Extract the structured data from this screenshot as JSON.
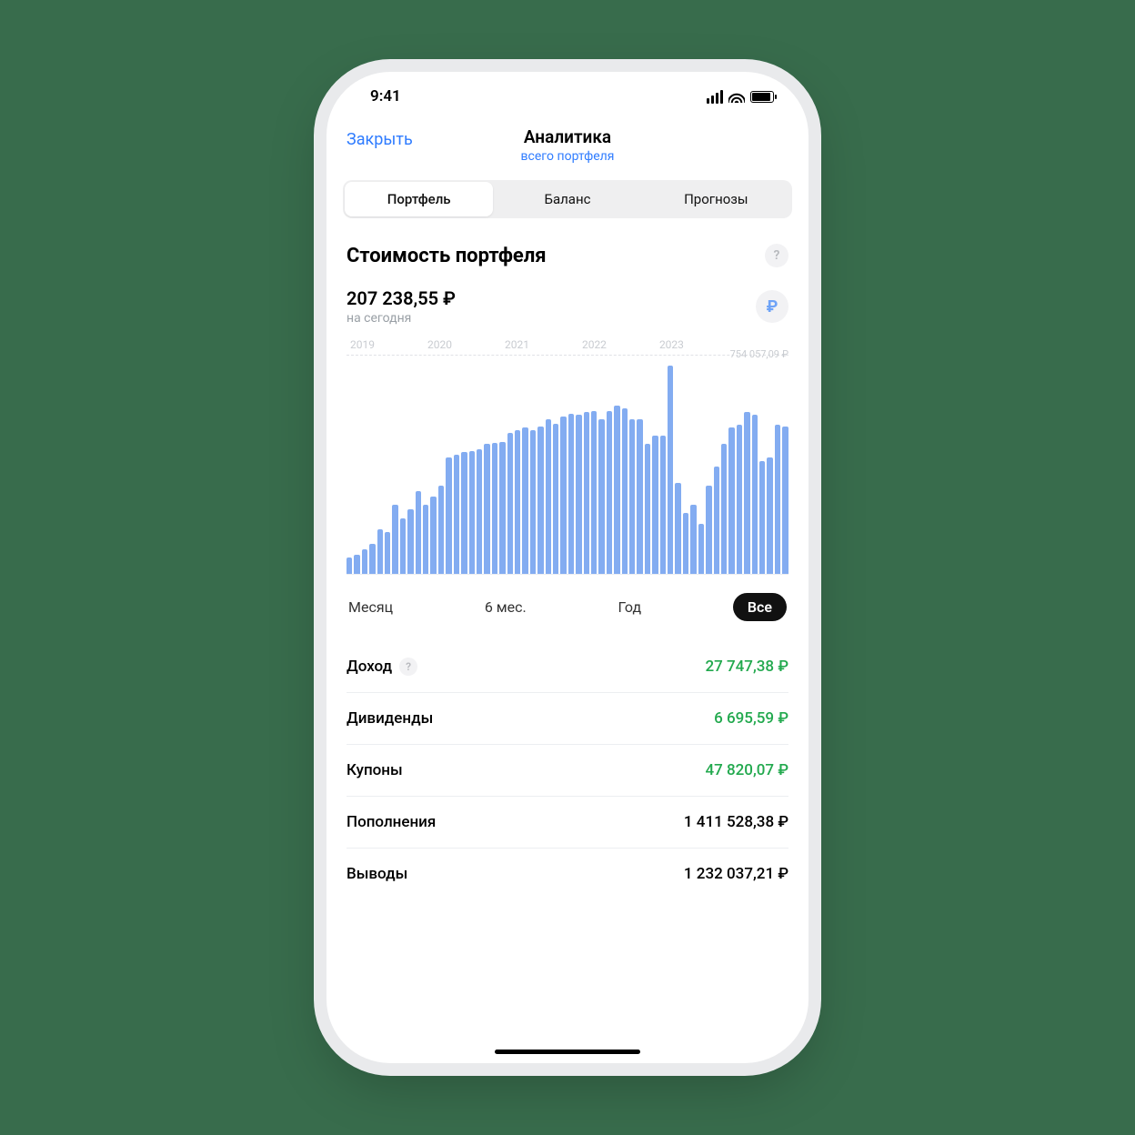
{
  "status": {
    "time": "9:41"
  },
  "nav": {
    "close": "Закрыть",
    "title": "Аналитика",
    "subtitle": "всего портфеля"
  },
  "segments": {
    "portfolio": "Портфель",
    "balance": "Баланс",
    "forecasts": "Прогнозы"
  },
  "section": {
    "title": "Стоимость портфеля",
    "help": "?"
  },
  "value": {
    "amount": "207 238,55 ₽",
    "sub": "на сегодня",
    "currency_symbol": "₽"
  },
  "period": {
    "month": "Месяц",
    "six": "6 мес.",
    "year": "Год",
    "all": "Все"
  },
  "rows": {
    "income": {
      "label": "Доход",
      "help": "?",
      "value": "27 747,38 ₽"
    },
    "dividends": {
      "label": "Дивиденды",
      "value": "6 695,59 ₽"
    },
    "coupons": {
      "label": "Купоны",
      "value": "47 820,07 ₽"
    },
    "deposits": {
      "label": "Пополнения",
      "value": "1 411 528,38 ₽"
    },
    "withdrawals": {
      "label": "Выводы",
      "value": "1 232 037,21 ₽"
    }
  },
  "chart_data": {
    "type": "bar",
    "title": "Стоимость портфеля",
    "xlabel": "",
    "ylabel": "₽",
    "ylim": [
      0,
      754057.09
    ],
    "max_label": "754 057,09 ₽",
    "year_labels": [
      "2019",
      "2020",
      "2021",
      "2022",
      "2023"
    ],
    "categories_note": "monthly points over 2019–2023 (approx.)",
    "values": [
      60000,
      70000,
      90000,
      110000,
      160000,
      150000,
      250000,
      200000,
      235000,
      300000,
      250000,
      280000,
      320000,
      420000,
      430000,
      440000,
      445000,
      450000,
      470000,
      475000,
      478000,
      510000,
      520000,
      530000,
      520000,
      535000,
      560000,
      545000,
      570000,
      580000,
      575000,
      585000,
      590000,
      560000,
      590000,
      610000,
      600000,
      560000,
      560000,
      470000,
      500000,
      500000,
      754057,
      330000,
      220000,
      250000,
      180000,
      320000,
      390000,
      470000,
      530000,
      540000,
      585000,
      575000,
      410000,
      420000,
      540000,
      535000
    ]
  }
}
